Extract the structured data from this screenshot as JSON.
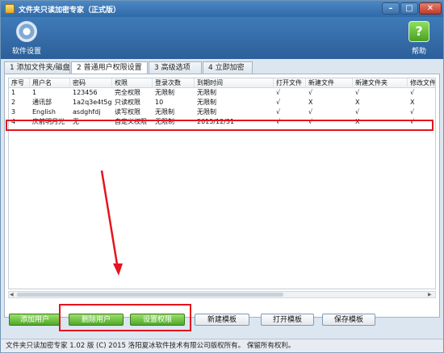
{
  "window": {
    "title": "文件夹只读加密专家（正式版）",
    "controls": {
      "minimize": "–",
      "maximize": "□",
      "close": "✕"
    }
  },
  "toolbar": {
    "settings_label": "软件设置",
    "settings_icon": "gear-icon",
    "help_label": "帮助",
    "help_glyph": "?"
  },
  "tabs": [
    {
      "label": "1 添加文件夹/磁盘"
    },
    {
      "label": "2 普通用户权限设置",
      "active": true
    },
    {
      "label": "3 高级选项"
    },
    {
      "label": "4 立即加密"
    }
  ],
  "table": {
    "columns": [
      "序号",
      "用户名",
      "密码",
      "权限",
      "登录次数",
      "到期时间",
      "打开文件",
      "新建文件",
      "新建文件夹",
      "修改文件"
    ],
    "rows": [
      [
        "1",
        "1",
        "123456",
        "完全权限",
        "无限制",
        "无限制",
        "√",
        "√",
        "√",
        "√"
      ],
      [
        "2",
        "通讯部",
        "1a2q3e4t5g",
        "只读权限",
        "10",
        "无限制",
        "√",
        "X",
        "X",
        "X"
      ],
      [
        "3",
        "English",
        "asdghfdj",
        "读写权限",
        "无限制",
        "无限制",
        "√",
        "√",
        "√",
        "√"
      ],
      [
        "4",
        "庆前明月光",
        "无",
        "自定义权限",
        "无限制",
        "2015/12/31",
        "√",
        "√",
        "X",
        "√"
      ]
    ]
  },
  "scrollbar": {
    "left": "◀",
    "right": "▶"
  },
  "buttons": {
    "add_user": "添加用户",
    "delete_user": "删除用户",
    "set_permission": "设置权限",
    "new_template": "新建模板",
    "open_template": "打开模板",
    "save_template": "保存模板"
  },
  "status": "文件夹只读加密专家 1.02 版 (C) 2015 洛阳夏冰软件技术有限公司版权所有。 保留所有权利。",
  "colors": {
    "annotation": "#e5141e",
    "titlebar": "#3a75b3",
    "green_button": "#5fb43a"
  }
}
